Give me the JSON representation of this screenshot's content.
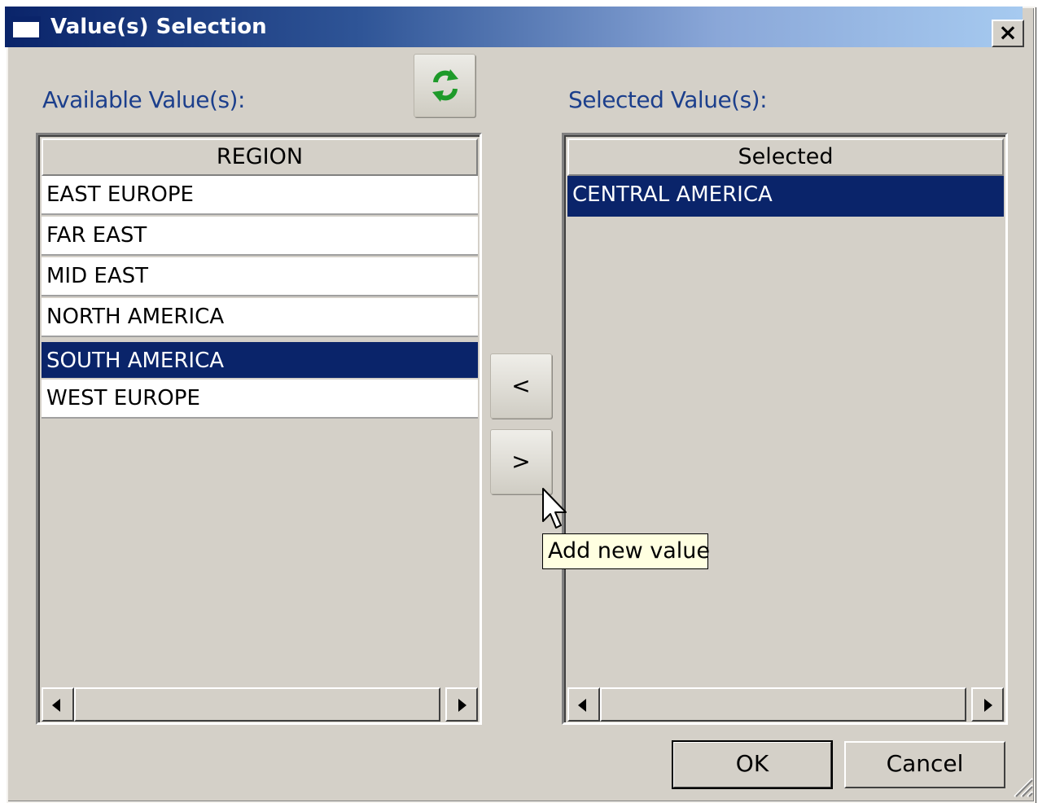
{
  "window": {
    "title": "Value(s) Selection",
    "close_label": "×"
  },
  "available": {
    "label": "Available Value(s):",
    "column_header": "REGION",
    "items": [
      {
        "label": "EAST EUROPE",
        "selected": false
      },
      {
        "label": "FAR EAST",
        "selected": false
      },
      {
        "label": "MID EAST",
        "selected": false
      },
      {
        "label": "NORTH AMERICA",
        "selected": false
      },
      {
        "label": "SOUTH AMERICA",
        "selected": true
      },
      {
        "label": "WEST EUROPE",
        "selected": false
      }
    ]
  },
  "selected": {
    "label": "Selected Value(s):",
    "column_header": "Selected",
    "items": [
      {
        "label": "CENTRAL AMERICA",
        "selected": true
      }
    ]
  },
  "move_buttons": {
    "remove_label": "<",
    "add_label": ">"
  },
  "tooltip": {
    "text": "Add new value"
  },
  "footer": {
    "ok_label": "OK",
    "cancel_label": "Cancel"
  },
  "colors": {
    "selection": "#0a246a",
    "dialog_face": "#d4d0c8",
    "label_text": "#1c3f8c",
    "tooltip_bg": "#ffffe1",
    "refresh_icon": "#1e9a2a"
  },
  "icons": {
    "refresh": "refresh-icon",
    "window": "window-icon",
    "cursor": "arrow-cursor-icon"
  }
}
